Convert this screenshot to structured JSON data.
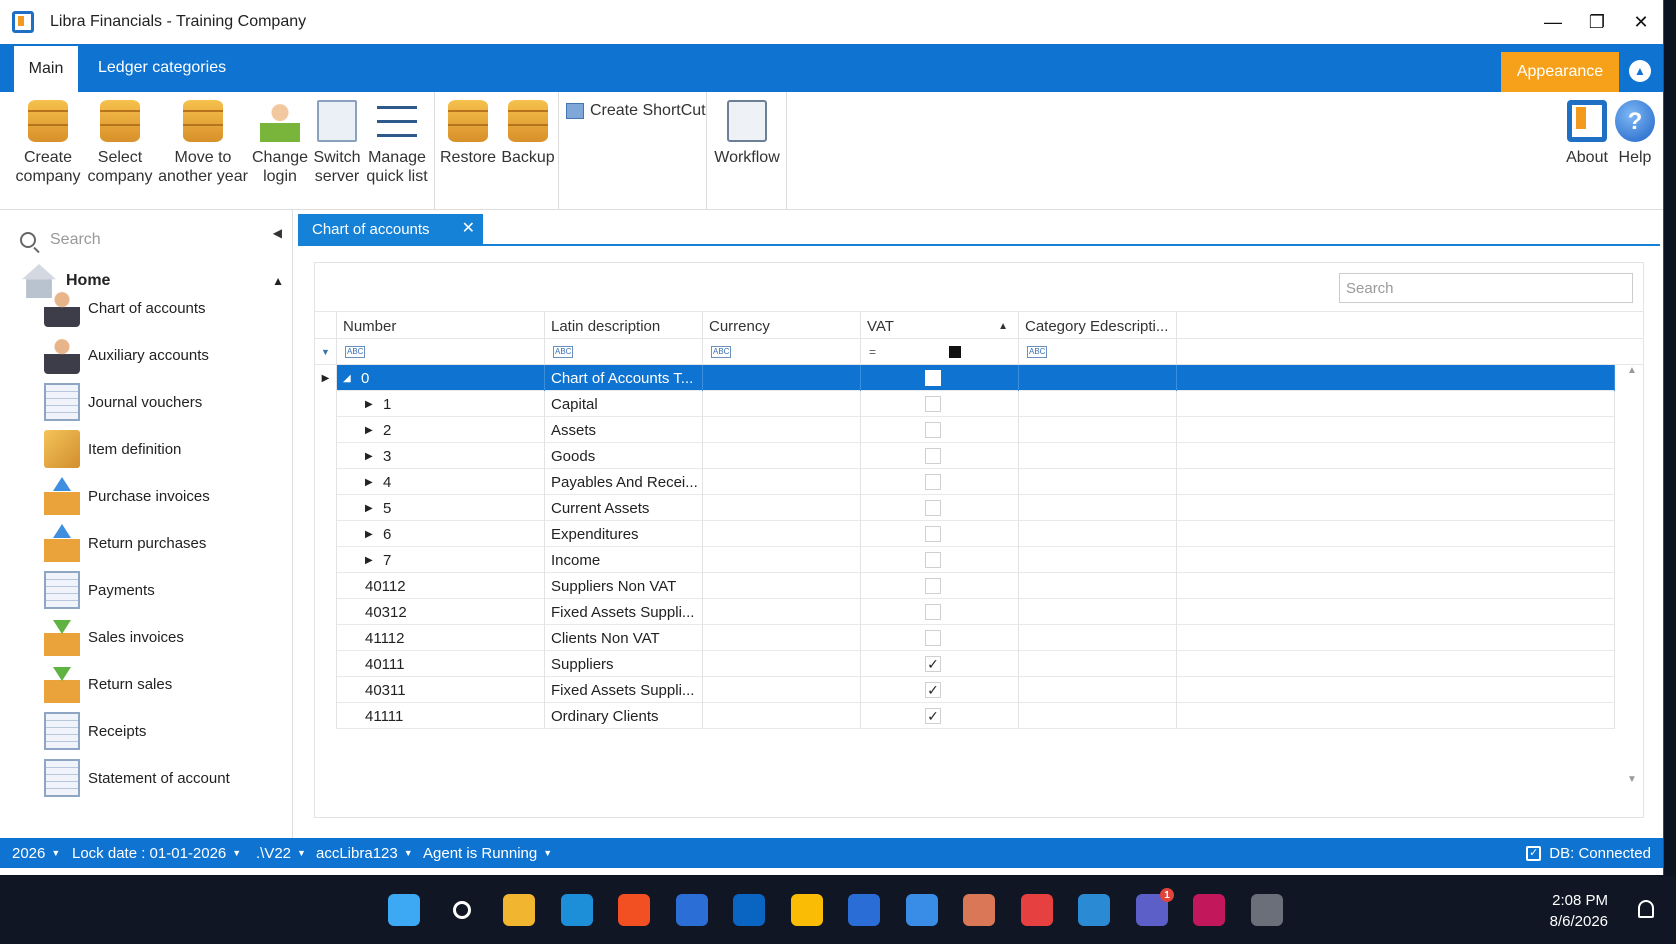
{
  "window": {
    "title": "Libra Financials - Training Company",
    "minimize": "—",
    "restore": "❐",
    "close": "✕"
  },
  "ribbon_tabs": {
    "main": "Main",
    "ledger": "Ledger categories",
    "appearance": "Appearance",
    "collapse": "▲"
  },
  "ribbon": {
    "create_company": [
      "Create",
      "company"
    ],
    "select_company": [
      "Select",
      "company"
    ],
    "move_year": [
      "Move to",
      "another year"
    ],
    "change_login": [
      "Change",
      "login"
    ],
    "switch_server": [
      "Switch",
      "server"
    ],
    "manage_quick": [
      "Manage",
      "quick list"
    ],
    "restore": "Restore",
    "backup": "Backup",
    "create_shortcut": "Create ShortCut",
    "workflow": "Workflow",
    "about": "About",
    "help": "Help"
  },
  "sidebar": {
    "search_placeholder": "Search",
    "collapse": "◀",
    "home": "Home",
    "home_chev": "▲",
    "items": [
      {
        "label": "Chart of accounts",
        "icon": "person-icon"
      },
      {
        "label": "Auxiliary accounts",
        "icon": "person-icon"
      },
      {
        "label": "Journal vouchers",
        "icon": "document-icon"
      },
      {
        "label": "Item definition",
        "icon": "box-icon"
      },
      {
        "label": "Purchase invoices",
        "icon": "upload-box-icon"
      },
      {
        "label": "Return purchases",
        "icon": "upload-box-icon"
      },
      {
        "label": "Payments",
        "icon": "document-icon"
      },
      {
        "label": "Sales invoices",
        "icon": "download-box-icon"
      },
      {
        "label": "Return sales",
        "icon": "download-box-icon"
      },
      {
        "label": "Receipts",
        "icon": "document-icon"
      },
      {
        "label": "Statement of account",
        "icon": "document-icon"
      }
    ]
  },
  "doc_tab": {
    "label": "Chart of accounts",
    "close": "✕"
  },
  "grid": {
    "search_placeholder": "Search",
    "columns": [
      "Number",
      "Latin description",
      "Currency",
      "VAT",
      "Category Edescripti..."
    ],
    "vat_sort": "▲",
    "filter_badges": [
      "ABC",
      "ABC",
      "ABC",
      "=",
      "",
      "ABC"
    ],
    "rows": [
      {
        "number": "0",
        "desc": "Chart of Accounts T...",
        "currency": "",
        "vat": false,
        "category": "",
        "level": 0,
        "expander": "◢",
        "selected": true
      },
      {
        "number": "1",
        "desc": "Capital",
        "currency": "",
        "vat": false,
        "category": "",
        "level": 1,
        "expander": "▶",
        "selected": false
      },
      {
        "number": "2",
        "desc": "Assets",
        "currency": "",
        "vat": false,
        "category": "",
        "level": 1,
        "expander": "▶",
        "selected": false
      },
      {
        "number": "3",
        "desc": "Goods",
        "currency": "",
        "vat": false,
        "category": "",
        "level": 1,
        "expander": "▶",
        "selected": false
      },
      {
        "number": "4",
        "desc": "Payables And Recei...",
        "currency": "",
        "vat": false,
        "category": "",
        "level": 1,
        "expander": "▶",
        "selected": false
      },
      {
        "number": "5",
        "desc": "Current Assets",
        "currency": "",
        "vat": false,
        "category": "",
        "level": 1,
        "expander": "▶",
        "selected": false
      },
      {
        "number": "6",
        "desc": "Expenditures",
        "currency": "",
        "vat": false,
        "category": "",
        "level": 1,
        "expander": "▶",
        "selected": false
      },
      {
        "number": "7",
        "desc": "Income",
        "currency": "",
        "vat": false,
        "category": "",
        "level": 1,
        "expander": "▶",
        "selected": false
      },
      {
        "number": "40112",
        "desc": "Suppliers Non VAT",
        "currency": "",
        "vat": false,
        "category": "",
        "level": 0,
        "expander": "",
        "selected": false
      },
      {
        "number": "40312",
        "desc": "Fixed Assets Suppli...",
        "currency": "",
        "vat": false,
        "category": "",
        "level": 0,
        "expander": "",
        "selected": false
      },
      {
        "number": "41112",
        "desc": "Clients Non VAT",
        "currency": "",
        "vat": false,
        "category": "",
        "level": 0,
        "expander": "",
        "selected": false
      },
      {
        "number": "40111",
        "desc": "Suppliers",
        "currency": "",
        "vat": true,
        "category": "",
        "level": 0,
        "expander": "",
        "selected": false
      },
      {
        "number": "40311",
        "desc": "Fixed Assets Suppli...",
        "currency": "",
        "vat": true,
        "category": "",
        "level": 0,
        "expander": "",
        "selected": false
      },
      {
        "number": "41111",
        "desc": "Ordinary Clients",
        "currency": "",
        "vat": true,
        "category": "",
        "level": 0,
        "expander": "",
        "selected": false
      }
    ]
  },
  "statusbar": {
    "year": "2026",
    "lock_date": "Lock date : 01-01-2026",
    "server": ".\\V22",
    "db": "accLibra123",
    "agent": "Agent is Running",
    "db_status": "DB: Connected"
  },
  "taskbar": {
    "time": "2:08 PM",
    "date": "8/6/2026",
    "teams_badge": "1",
    "apps": [
      "windows-start-icon",
      "search-icon",
      "file-explorer-icon",
      "edge-icon",
      "store-icon",
      "outlook-new-icon",
      "outlook-icon",
      "chrome-icon",
      "dev-app-icon",
      "photos-icon",
      "claude-icon",
      "remote-desktop-icon",
      "vscode-icon",
      "teams-icon",
      "libra-icon",
      "settings-icon"
    ]
  },
  "colors": {
    "accent": "#0f74d1",
    "appearance": "#f7a11a",
    "selected_row": "#0f74d1"
  }
}
